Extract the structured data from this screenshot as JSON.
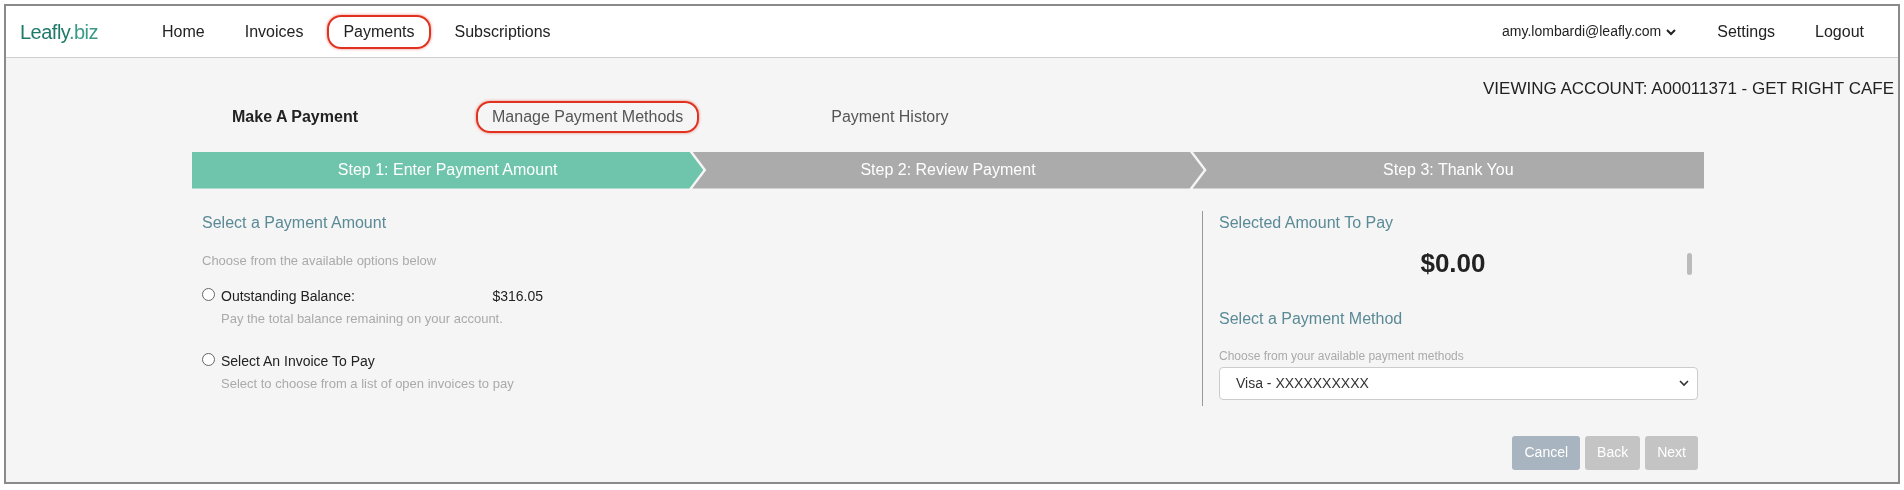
{
  "header": {
    "logo": {
      "name": "Leafly",
      "suffix": ".biz"
    },
    "nav": [
      {
        "label": "Home",
        "annotated": false
      },
      {
        "label": "Invoices",
        "annotated": false
      },
      {
        "label": "Payments",
        "annotated": true
      },
      {
        "label": "Subscriptions",
        "annotated": false
      }
    ],
    "user_menu": "amy.lombardi@leafly.com",
    "links": [
      "Settings",
      "Logout"
    ]
  },
  "account_banner": "VIEWING ACCOUNT: A00011371 - GET RIGHT CAFE",
  "tabs": [
    {
      "label": "Make A Payment",
      "selected": true,
      "annotated": false
    },
    {
      "label": "Manage Payment Methods",
      "selected": false,
      "annotated": true
    },
    {
      "label": "Payment History",
      "selected": false,
      "annotated": false
    }
  ],
  "steps": [
    {
      "label": "Step 1: Enter Payment Amount",
      "selected": true
    },
    {
      "label": "Step 2: Review Payment",
      "selected": false
    },
    {
      "label": "Step 3: Thank You",
      "selected": false
    }
  ],
  "amount_section": {
    "title": "Select a Payment Amount",
    "hint": "Choose from the available options below",
    "options": [
      {
        "label": "Outstanding Balance:",
        "amount": "$316.05",
        "description": "Pay the total balance remaining on your account.",
        "checked": false
      },
      {
        "label": "Select An Invoice To Pay",
        "description": "Select to choose from a list of open invoices to pay",
        "checked": false
      }
    ]
  },
  "summary": {
    "title": "Selected Amount To Pay",
    "amount": "$0.00",
    "method_title": "Select a Payment Method",
    "method_hint": "Choose from your available payment methods",
    "method_value": "Visa - XXXXXXXXXX"
  },
  "buttons": [
    {
      "label": "Cancel",
      "kind": "cancel",
      "disabled": false
    },
    {
      "label": "Back",
      "kind": "nav",
      "disabled": true
    },
    {
      "label": "Next",
      "kind": "nav",
      "disabled": true
    }
  ]
}
